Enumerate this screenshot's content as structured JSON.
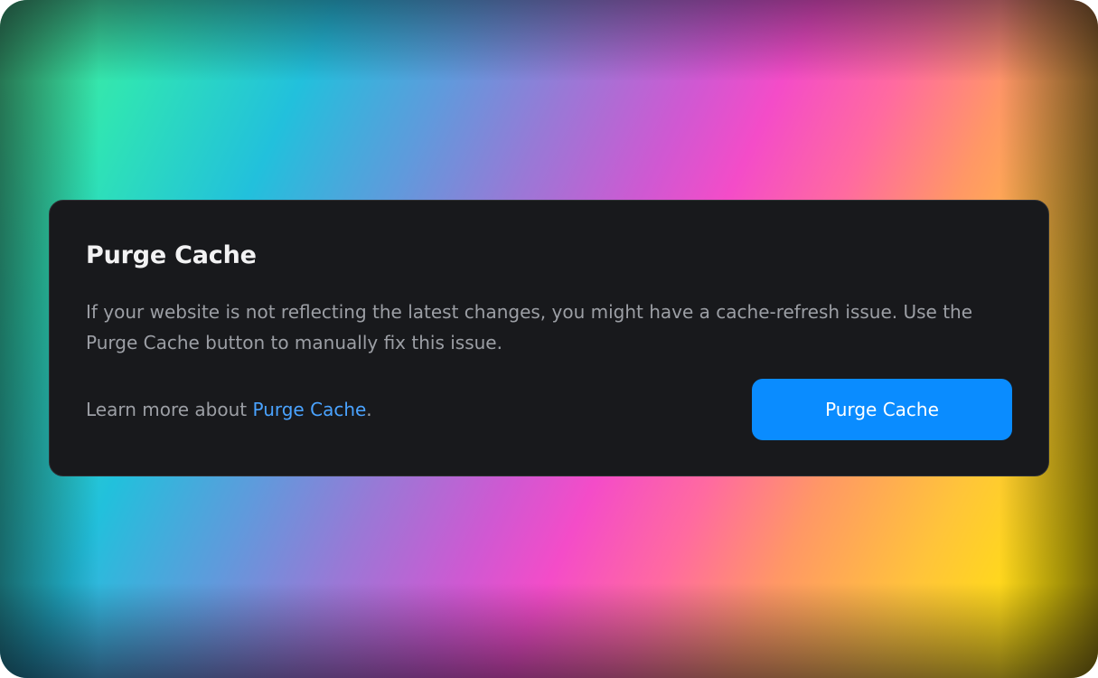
{
  "background": {
    "colors": [
      "#4ff08a",
      "#22c0dc",
      "#9a78d6",
      "#f44cc8",
      "#ff9766",
      "#ffe40a"
    ]
  },
  "card": {
    "title": "Purge Cache",
    "description": "If your website is not reflecting the latest changes, you might have a cache-refresh issue. Use the Purge Cache button to manually fix this issue.",
    "learn_prefix": "Learn more about ",
    "learn_link": "Purge Cache",
    "learn_suffix": ".",
    "button_label": "Purge Cache",
    "colors": {
      "card_bg": "#18191c",
      "accent": "#0a8cff",
      "link": "#4aa3ff"
    }
  }
}
